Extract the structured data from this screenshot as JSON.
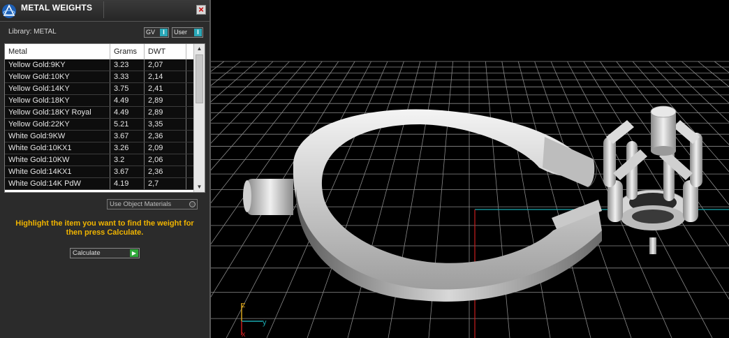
{
  "panel": {
    "title": "METAL WEIGHTS",
    "close_label": "×",
    "library_label": "Library: METAL",
    "gv_label": "GV",
    "user_label": "User",
    "toggle_indicator": "I"
  },
  "table": {
    "headers": [
      "Metal",
      "Grams",
      "DWT"
    ],
    "rows": [
      {
        "metal": "Yellow Gold:9KY",
        "grams": "3.23",
        "dwt": "2,07"
      },
      {
        "metal": "Yellow Gold:10KY",
        "grams": "3.33",
        "dwt": "2,14"
      },
      {
        "metal": "Yellow Gold:14KY",
        "grams": "3.75",
        "dwt": "2,41"
      },
      {
        "metal": "Yellow Gold:18KY",
        "grams": "4.49",
        "dwt": "2,89"
      },
      {
        "metal": "Yellow Gold:18KY Royal",
        "grams": "4.49",
        "dwt": "2,89"
      },
      {
        "metal": "Yellow Gold:22KY",
        "grams": "5.21",
        "dwt": "3,35"
      },
      {
        "metal": "White Gold:9KW",
        "grams": "3.67",
        "dwt": "2,36"
      },
      {
        "metal": "White Gold:10KX1",
        "grams": "3.26",
        "dwt": "2,09"
      },
      {
        "metal": "White Gold:10KW",
        "grams": "3.2",
        "dwt": "2,06"
      },
      {
        "metal": "White Gold:14KX1",
        "grams": "3.67",
        "dwt": "2,36"
      },
      {
        "metal": "White Gold:14K PdW",
        "grams": "4.19",
        "dwt": "2,7"
      }
    ],
    "scroll_up": "▲",
    "scroll_down": "▼"
  },
  "options": {
    "use_object_materials": "Use Object Materials"
  },
  "instructions": "Highlight the item you want to find the weight for then press Calculate.",
  "calculate": {
    "label": "Calculate",
    "go_icon": "▶"
  },
  "viewport": {
    "axis_z": "z",
    "axis_y": "y",
    "axis_x": "x"
  },
  "colors": {
    "panel_bg": "#2b2b2b",
    "instruction_text": "#f0b400",
    "accent_teal": "#2aa8b8",
    "calculate_go": "#2fa83a",
    "grid": "#8a8a8a",
    "axis_red": "#c81e1e",
    "axis_cyan": "#1aa9b0"
  }
}
